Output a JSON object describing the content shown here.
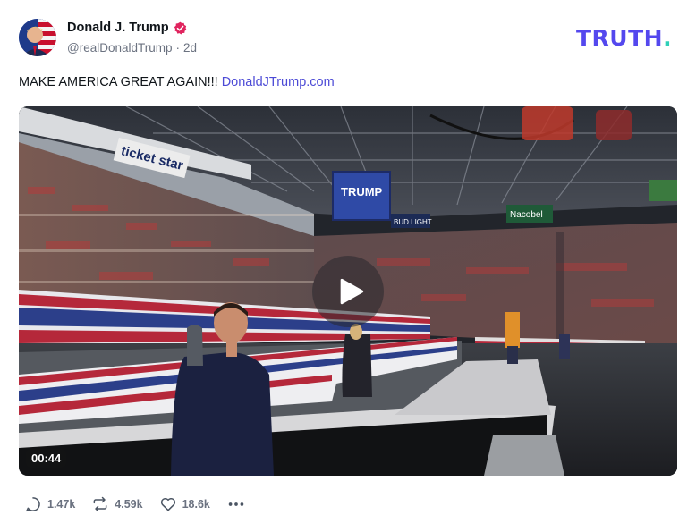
{
  "author": {
    "display_name": "Donald J. Trump",
    "handle": "@realDonaldTrump",
    "separator": "·",
    "age": "2d",
    "verified_color": "#e0245e"
  },
  "brand": {
    "name": "TRUTH",
    "dot": ".",
    "color": "#5448ee",
    "dot_color": "#2fd0b8"
  },
  "post": {
    "text": "MAKE AMERICA GREAT AGAIN!!!",
    "link_text": "DonaldJTrump.com",
    "link_color": "#4c4ad6"
  },
  "media": {
    "duration": "00:44",
    "play_icon": "play-icon",
    "scene_text": {
      "ticket_sign": "ticket star",
      "screen_text": "TRUMP",
      "bud_light": "BUD LIGHT",
      "nacobel": "Nacobel"
    }
  },
  "actions": {
    "replies": {
      "icon": "reply-icon",
      "count": "1.47k"
    },
    "retruths": {
      "icon": "retruth-icon",
      "count": "4.59k"
    },
    "likes": {
      "icon": "heart-icon",
      "count": "18.6k"
    },
    "more": {
      "icon": "more-icon"
    }
  }
}
